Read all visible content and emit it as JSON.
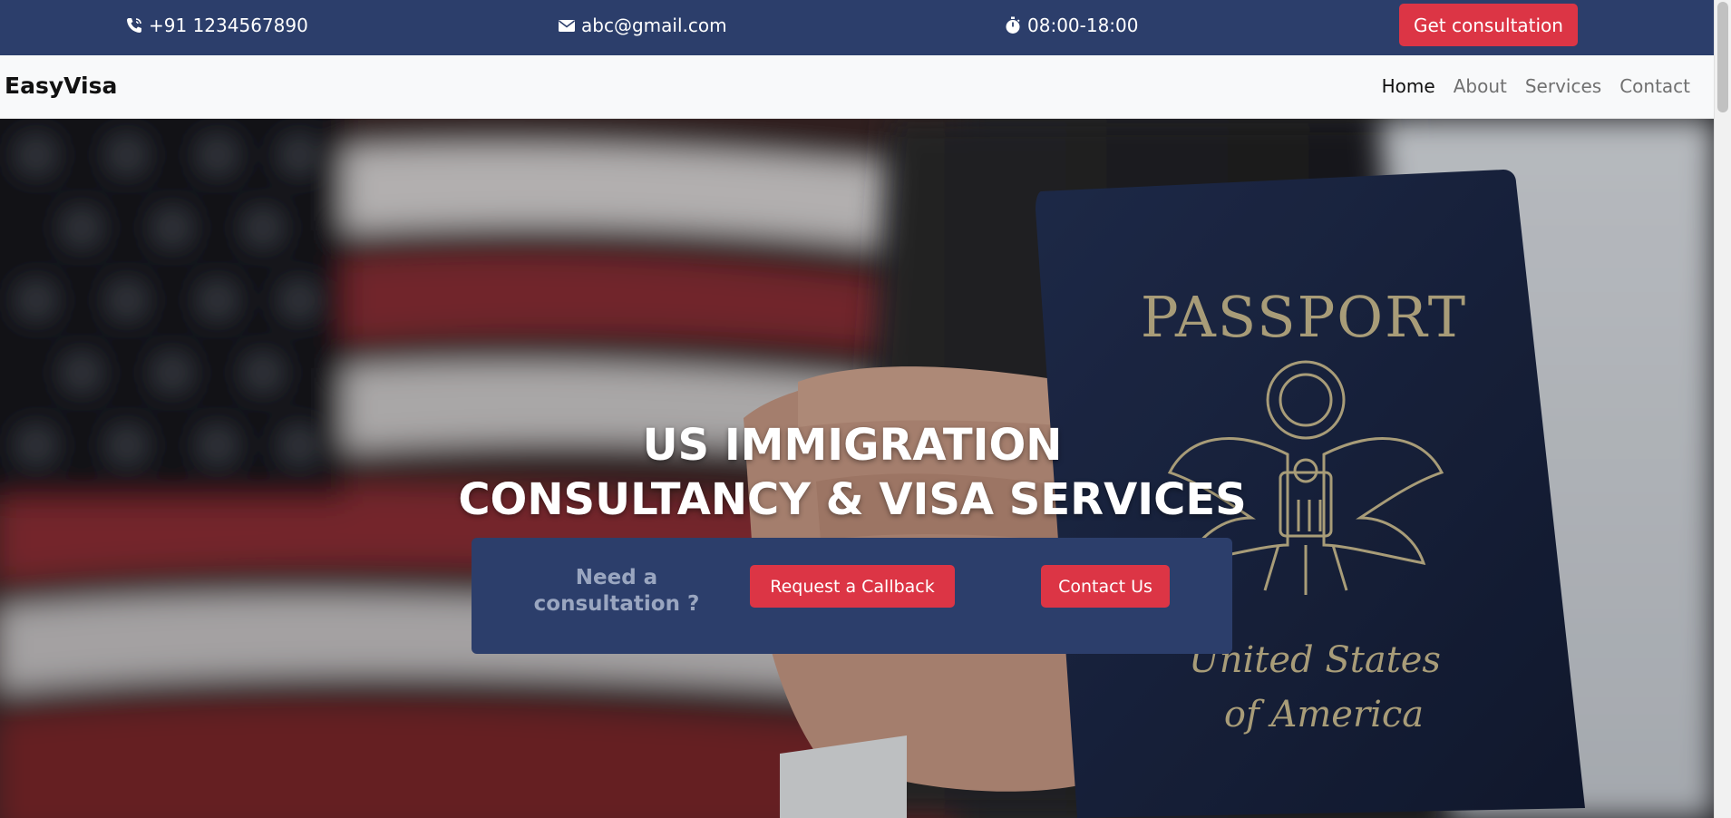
{
  "topbar": {
    "phone": "+91 1234567890",
    "email": "abc@gmail.com",
    "hours": "08:00-18:00",
    "consult_label": "Get consultation",
    "icons": [
      "phone-icon",
      "envelope-icon",
      "stopwatch-icon"
    ]
  },
  "navbar": {
    "brand": "EasyVisa",
    "links": [
      {
        "label": "Home",
        "active": true
      },
      {
        "label": "About",
        "active": false
      },
      {
        "label": "Services",
        "active": false
      },
      {
        "label": "Contact",
        "active": false
      }
    ]
  },
  "hero": {
    "title_line1": "US IMMIGRATION",
    "title_line2": "CONSULTANCY & VISA SERVICES",
    "passport_text_top": "PASSPORT",
    "passport_text_bottom1": "United States",
    "passport_text_bottom2": "of America"
  },
  "consult_panel": {
    "prompt": "Need a consultation ?",
    "callback_label": "Request a Callback",
    "contact_label": "Contact Us"
  },
  "colors": {
    "primary_navy": "#2c3e6b",
    "accent_red": "#dc3545",
    "navbar_bg": "#f8f9fa"
  }
}
